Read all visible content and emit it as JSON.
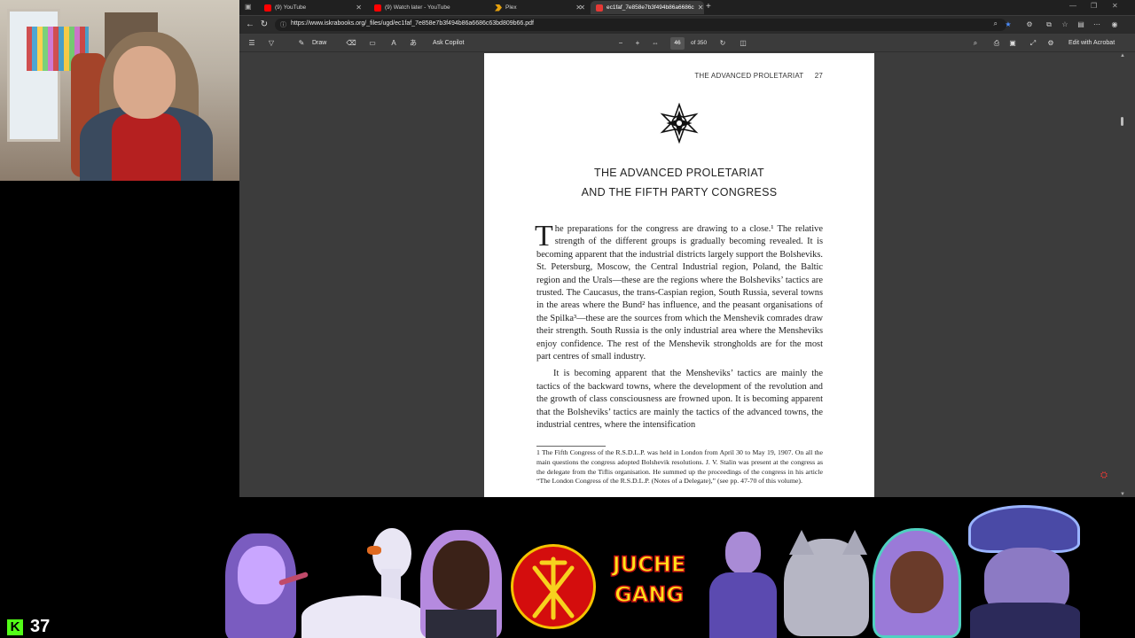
{
  "browser": {
    "tabs": [
      {
        "label": "(9) YouTube",
        "icon": "youtube-icon",
        "color": "#ff0000"
      },
      {
        "label": "(9) Watch later - YouTube",
        "icon": "youtube-icon",
        "color": "#ff0000"
      },
      {
        "label": "Plex",
        "icon": "plex-icon",
        "color": "#e5a00d"
      },
      {
        "label": "ec1faf_7e858e7b3f494b86a6686c",
        "icon": "pdf-icon",
        "color": "#e53935",
        "active": true
      }
    ],
    "new_tab": "+",
    "url": "https://www.iskrabooks.org/_files/ugd/ec1faf_7e858e7b3f494b86a6686c63bd809b66.pdf"
  },
  "pdf_toolbar": {
    "draw_label": "Draw",
    "copilot_label": "Ask Copilot",
    "zoom_out": "−",
    "zoom_in": "+",
    "current_page": "46",
    "page_count": "of 350",
    "edit_label": "Edit with Acrobat"
  },
  "page": {
    "running_head": "THE ADVANCED PROLETARIAT",
    "page_number": "27",
    "title_line1": "THE ADVANCED PROLETARIAT",
    "title_line2": "AND THE FIFTH PARTY CONGRESS",
    "dropcap": "T",
    "para1": "he preparations for the congress are drawing to a close.¹ The relative strength of the different groups is gradually becoming revealed. It is becoming apparent that the industrial districts largely support the Bolsheviks. St. Petersburg, Moscow, the Central Industrial region, Poland, the Baltic region and the Urals—these are the regions where the Bolsheviks’ tactics are trusted. The Caucasus, the trans-Caspian region, South Russia, several towns in the areas where the Bund² has influence, and the peasant organisations of the Spilka³—these are the sources from which the Menshevik comrades draw their strength. South Russia is the only industrial area where the Mensheviks enjoy confidence. The rest of the Menshevik strongholds are for the most part centres of small industry.",
    "para2": "It is becoming apparent that the Mensheviks’ tactics are mainly the tactics of the backward towns, where the development of the revolution and the growth of class consciousness are frowned upon. It is becoming apparent that the Bolsheviks’ tactics are mainly the tactics of the advanced towns, the industrial centres, where the intensification",
    "footnote": "1  The Fifth Congress of the R.S.D.L.P. was held in London from April 30 to May 19, 1907. On all the main questions the congress adopted Bolshevik resolutions. J. V. Stalin was present at the congress as the delegate from the Tiflis organisation. He summed up the proceedings of the congress in his article “The London Congress of the R.S.D.L.P. (Notes of a Delegate),” (see pp. 47-70 of this volume)."
  },
  "overlay": {
    "viewer_count": "37",
    "sticker_line1": "JUCHE",
    "sticker_line2": "GANG",
    "kick_color": "#53fc18"
  }
}
